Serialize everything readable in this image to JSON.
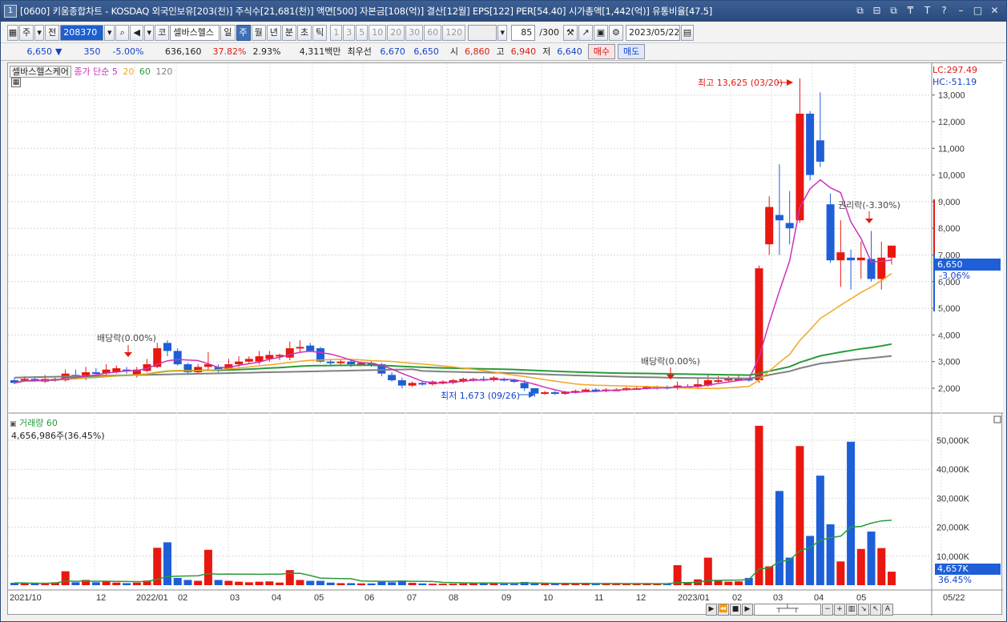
{
  "window": {
    "number": "1",
    "title": "[0600] 키움종합차트 - KOSDAQ 외국인보유[203(천)] 주식수[21,681(천)] 액면[500] 자본금[108(억)] 결산[12월] EPS[122] PER[54.40] 시가총액[1,442(억)] 유통비율[47.5]",
    "controls": [
      "⧉",
      "⊟",
      "⧉",
      "₸",
      "T",
      "?",
      "–",
      "□",
      "✕"
    ]
  },
  "toolbar": {
    "type_btn": "주",
    "prev_btn": "전",
    "code": "208370",
    "search_icon": "🔍",
    "sound_icon": "◀",
    "market_btn": "코",
    "stock_name": "셀바스헬스",
    "periods": [
      "일",
      "주",
      "월",
      "년",
      "분",
      "초",
      "틱"
    ],
    "active_period": "주",
    "ticks": [
      "1",
      "3",
      "5",
      "10",
      "20",
      "30",
      "60",
      "120"
    ],
    "count": "85",
    "total": "/300",
    "date": "2023/05/22"
  },
  "quote": {
    "price": "6,650",
    "arrow": "▼",
    "change": "350",
    "change_pct": "-5.00%",
    "volume": "636,160",
    "vol_ratio": "37.82%",
    "turnover": "2.93%",
    "amount": "4,311백만",
    "pref_label": "최우선",
    "ask": "6,670",
    "bid": "6,650",
    "open_label": "시",
    "open": "6,860",
    "high_label": "고",
    "high": "6,940",
    "low_label": "저",
    "low": "6,640",
    "buy_btn": "매수",
    "sell_btn": "매도"
  },
  "price_panel": {
    "legend_name": "셀바스헬스케어",
    "ma_label": "종가 단순",
    "ma5": "5",
    "ma20": "20",
    "ma60": "60",
    "ma120": "120",
    "lc": "LC:297.49",
    "hc": "HC:-51.19",
    "current_price": "6,650",
    "current_change": "-3.06%",
    "annotations": {
      "high": "최고 13,625 (03/20)",
      "low": "최저 1,673 (09/26)",
      "div1": "배당락(0.00%)",
      "div2": "배당락(0.00%)",
      "rights": "권리락(-3.30%)"
    }
  },
  "volume_panel": {
    "legend": "거래량",
    "ma": "60",
    "info": "4,656,986주(36.45%)",
    "current": "4,657K",
    "current_pct": "36.45%"
  },
  "chart_data": {
    "type": "candlestick",
    "y_ticks": [
      2000,
      3000,
      4000,
      5000,
      6000,
      7000,
      8000,
      9000,
      10000,
      11000,
      12000,
      13000
    ],
    "x_labels": [
      "2021/10",
      "12",
      "2022/01",
      "02",
      "03",
      "04",
      "05",
      "06",
      "07",
      "08",
      "09",
      "10",
      "11",
      "12",
      "2023/01",
      "02",
      "03",
      "04",
      "05",
      "05/22"
    ],
    "vol_ticks": [
      "10,000K",
      "20,000K",
      "30,000K",
      "40,000K",
      "50,000K"
    ],
    "colors": {
      "up": "#e8170f",
      "down": "#1e5fd8",
      "ma5": "#cc33bb",
      "ma20": "#f0a820",
      "ma60": "#2a9a3a",
      "ma120": "#808080"
    }
  }
}
